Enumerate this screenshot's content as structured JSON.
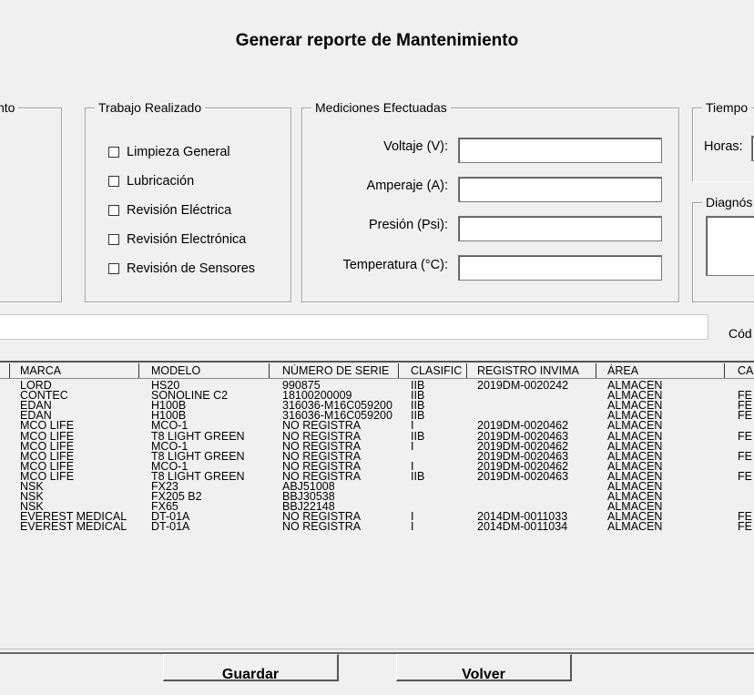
{
  "title": "Generar reporte de Mantenimiento",
  "left_group": {
    "legend": "nto"
  },
  "trabajo": {
    "legend": "Trabajo Realizado",
    "items": [
      "Limpieza General",
      "Lubricación",
      "Revisión Eléctrica",
      "Revisión Electrónica",
      "Revisión de Sensores"
    ]
  },
  "mediciones": {
    "legend": "Mediciones Efectuadas",
    "fields": [
      {
        "label": "Voltaje (V):",
        "value": ""
      },
      {
        "label": "Amperaje (A):",
        "value": ""
      },
      {
        "label": "Presión (Psi):",
        "value": ""
      },
      {
        "label": "Temperatura (°C):",
        "value": ""
      }
    ]
  },
  "tiempo": {
    "legend": "Tiempo",
    "horas_label": "Horas:"
  },
  "diagnostico": {
    "legend": "Diagnós"
  },
  "search": {
    "value": "",
    "codigo_label": "Cód"
  },
  "table": {
    "columns": [
      "MARCA",
      "MODELO",
      "NÚMERO DE SERIE",
      "CLASIFIC",
      "REGISTRO INVIMA",
      "ÁREA",
      "CA"
    ],
    "rows": [
      [
        "LORD",
        "HS20",
        "990875",
        "IIB",
        "2019DM-0020242",
        "ALMACÉN",
        ""
      ],
      [
        "CONTEC",
        "SONOLINE C2",
        "18100200009",
        "IIB",
        "",
        "ALMACÉN",
        "FE"
      ],
      [
        "EDAN",
        "H100B",
        "316036-M16C059200",
        "IIB",
        "",
        "ALMACÉN",
        "FE"
      ],
      [
        "EDAN",
        "H100B",
        "316036-M16C059200",
        "IIB",
        "",
        "ALMACÉN",
        "FE"
      ],
      [
        "MCO LIFE",
        "MCO-1",
        "NO REGISTRA",
        "I",
        "2019DM-0020462",
        "ALMACÉN",
        ""
      ],
      [
        "MCO LIFE",
        "T8 LIGHT GREEN",
        "NO REGISTRA",
        "IIB",
        "2019DM-0020463",
        "ALMACÉN",
        "FE"
      ],
      [
        "MCO LIFE",
        "MCO-1",
        "NO REGISTRA",
        "I",
        "2019DM-0020462",
        "ALMACÉN",
        ""
      ],
      [
        "MCO LIFE",
        "T8 LIGHT GREEN",
        "NO REGISTRA",
        "",
        "2019DM-0020463",
        "ALMACÉN",
        "FE"
      ],
      [
        "MCO LIFE",
        "MCO-1",
        "NO REGISTRA",
        "I",
        "2019DM-0020462",
        "ALMACÉN",
        ""
      ],
      [
        "MCO LIFE",
        "T8 LIGHT GREEN",
        "NO REGISTRA",
        "IIB",
        "2019DM-0020463",
        "ALMACÉN",
        "FE"
      ],
      [
        "NSK",
        "FX23",
        "ABJ51008",
        "",
        "",
        "ALMACÉN",
        ""
      ],
      [
        "NSK",
        "FX205 B2",
        "BBJ30538",
        "",
        "",
        "ALMACÉN",
        ""
      ],
      [
        "NSK",
        "FX65",
        "BBJ22148",
        "",
        "",
        "ALMACÉN",
        ""
      ],
      [
        "EVEREST MEDICAL",
        "DT-01A",
        "NO REGISTRA",
        "I",
        "2014DM-0011033",
        "ALMACÉN",
        "FE"
      ],
      [
        "EVEREST MEDICAL",
        "DT-01A",
        "NO REGISTRA",
        "I",
        "2014DM-0011034",
        "ALMACÉN",
        "FE"
      ]
    ]
  },
  "buttons": {
    "guardar": "Guardar",
    "volver": "Volver"
  }
}
